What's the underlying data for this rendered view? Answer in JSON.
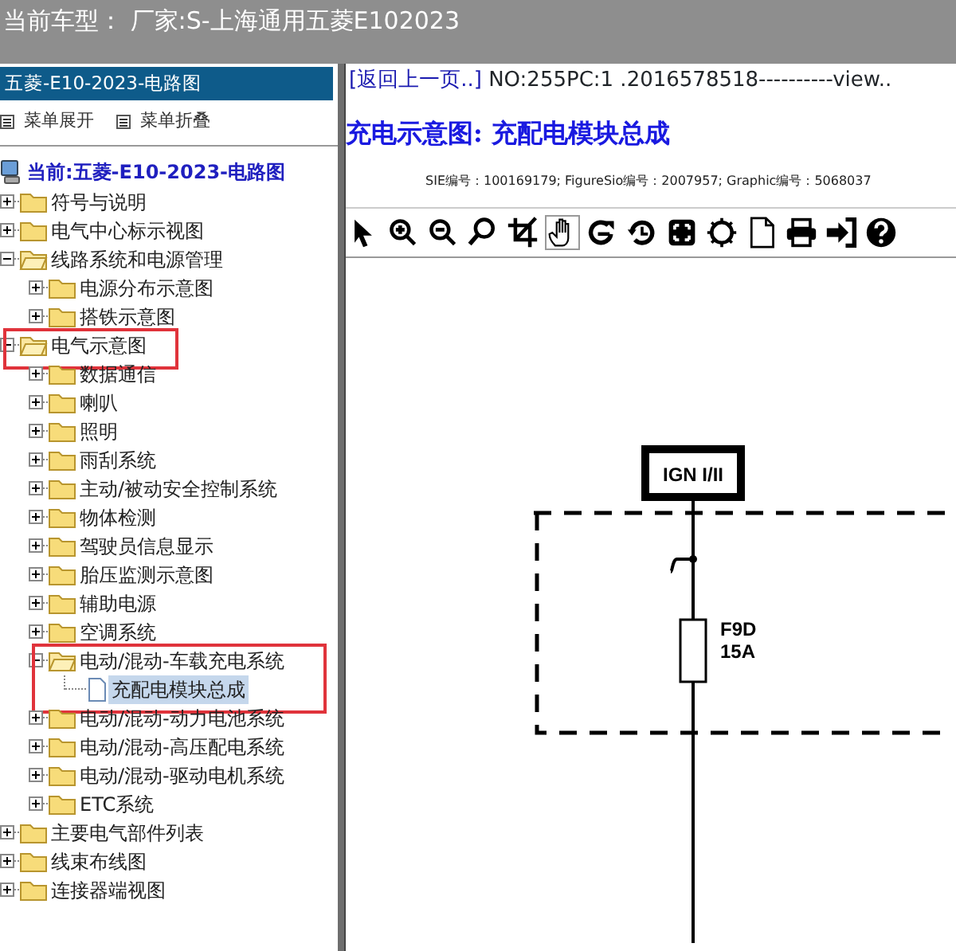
{
  "header": {
    "title": "当前车型：  厂家:S-上海通用五菱E102023"
  },
  "sidebar": {
    "title": "五菱-E10-2023-电路图",
    "menu": [
      {
        "label": "菜单展开"
      },
      {
        "label": "菜单折叠"
      }
    ],
    "root": "当前:五菱-E10-2023-电路图",
    "tree": [
      {
        "label": "符号与说明",
        "kind": "folder",
        "expanded": false,
        "selected": false,
        "highlighted": false
      },
      {
        "label": "电气中心标示视图",
        "kind": "folder",
        "expanded": false,
        "selected": false,
        "highlighted": false
      },
      {
        "label": "线路系统和电源管理",
        "kind": "folder",
        "expanded": true,
        "selected": false,
        "highlighted": false,
        "children": [
          {
            "label": "电源分布示意图",
            "kind": "folder",
            "expanded": false,
            "selected": false,
            "highlighted": false
          },
          {
            "label": "搭铁示意图",
            "kind": "folder",
            "expanded": false,
            "selected": false,
            "highlighted": false
          }
        ]
      },
      {
        "label": "电气示意图",
        "kind": "folder",
        "expanded": true,
        "selected": false,
        "highlighted": true,
        "children": [
          {
            "label": "数据通信",
            "kind": "folder",
            "expanded": false,
            "selected": false,
            "highlighted": false
          },
          {
            "label": "喇叭",
            "kind": "folder",
            "expanded": false,
            "selected": false,
            "highlighted": false
          },
          {
            "label": "照明",
            "kind": "folder",
            "expanded": false,
            "selected": false,
            "highlighted": false
          },
          {
            "label": "雨刮系统",
            "kind": "folder",
            "expanded": false,
            "selected": false,
            "highlighted": false
          },
          {
            "label": "主动/被动安全控制系统",
            "kind": "folder",
            "expanded": false,
            "selected": false,
            "highlighted": false
          },
          {
            "label": "物体检测",
            "kind": "folder",
            "expanded": false,
            "selected": false,
            "highlighted": false
          },
          {
            "label": "驾驶员信息显示",
            "kind": "folder",
            "expanded": false,
            "selected": false,
            "highlighted": false
          },
          {
            "label": "胎压监测示意图",
            "kind": "folder",
            "expanded": false,
            "selected": false,
            "highlighted": false
          },
          {
            "label": "辅助电源",
            "kind": "folder",
            "expanded": false,
            "selected": false,
            "highlighted": false
          },
          {
            "label": "空调系统",
            "kind": "folder",
            "expanded": false,
            "selected": false,
            "highlighted": false
          },
          {
            "label": "电动/混动-车载充电系统",
            "kind": "folder",
            "expanded": true,
            "selected": false,
            "highlighted": true,
            "children": [
              {
                "label": "充配电模块总成",
                "kind": "document",
                "expanded": false,
                "selected": true,
                "highlighted": false
              }
            ]
          },
          {
            "label": "电动/混动-动力电池系统",
            "kind": "folder",
            "expanded": false,
            "selected": false,
            "highlighted": false
          },
          {
            "label": "电动/混动-高压配电系统",
            "kind": "folder",
            "expanded": false,
            "selected": false,
            "highlighted": false
          },
          {
            "label": "电动/混动-驱动电机系统",
            "kind": "folder",
            "expanded": false,
            "selected": false,
            "highlighted": false
          },
          {
            "label": "ETC系统",
            "kind": "folder",
            "expanded": false,
            "selected": false,
            "highlighted": false
          }
        ]
      },
      {
        "label": "主要电气部件列表",
        "kind": "folder",
        "expanded": false,
        "selected": false,
        "highlighted": false
      },
      {
        "label": "线束布线图",
        "kind": "folder",
        "expanded": false,
        "selected": false,
        "highlighted": false
      },
      {
        "label": "连接器端视图",
        "kind": "folder",
        "expanded": false,
        "selected": false,
        "highlighted": false
      }
    ]
  },
  "content": {
    "back_link": "[返回上一页..]",
    "info": "NO:255PC:1 .2016578518----------view..",
    "title": "充电示意图: 充配电模块总成",
    "ids": "SIE编号：100169179;  FigureSio编号：2007957;  Graphic编号：5068037",
    "toolbar": [
      {
        "kind": "pointer",
        "selected": false
      },
      {
        "kind": "zoom-in",
        "selected": false
      },
      {
        "kind": "zoom-out",
        "selected": false
      },
      {
        "kind": "search",
        "selected": false
      },
      {
        "kind": "crop",
        "selected": false
      },
      {
        "kind": "hand",
        "selected": true
      },
      {
        "kind": "redo",
        "selected": false
      },
      {
        "kind": "history",
        "selected": false
      },
      {
        "kind": "fit",
        "selected": false
      },
      {
        "kind": "settings",
        "selected": false
      },
      {
        "kind": "page",
        "selected": false
      },
      {
        "kind": "print",
        "selected": false
      },
      {
        "kind": "exit",
        "selected": false
      },
      {
        "kind": "help",
        "selected": false
      }
    ],
    "diagram": {
      "connector": "IGN I/II",
      "fuse": "F9D",
      "rating": "15A"
    }
  }
}
